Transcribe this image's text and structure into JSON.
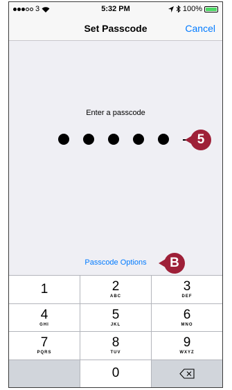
{
  "status_bar": {
    "carrier": "3",
    "time": "5:32 PM",
    "battery": "100%",
    "battery_level": 1.0,
    "signal_bars_filled": 3
  },
  "nav": {
    "title": "Set Passcode",
    "cancel": "Cancel"
  },
  "prompt": "Enter a passcode",
  "passcode": {
    "digits_entered": 5,
    "digits_total": 6
  },
  "options_link": "Passcode Options",
  "keypad": {
    "keys": [
      {
        "num": "1",
        "letters": ""
      },
      {
        "num": "2",
        "letters": "ABC"
      },
      {
        "num": "3",
        "letters": "DEF"
      },
      {
        "num": "4",
        "letters": "GHI"
      },
      {
        "num": "5",
        "letters": "JKL"
      },
      {
        "num": "6",
        "letters": "MNO"
      },
      {
        "num": "7",
        "letters": "PQRS"
      },
      {
        "num": "8",
        "letters": "TUV"
      },
      {
        "num": "9",
        "letters": "WXYZ"
      }
    ],
    "zero": "0",
    "delete_icon": "backspace-icon"
  },
  "callouts": {
    "five": "5",
    "b": "B",
    "color": "#9e2038"
  },
  "colors": {
    "accent": "#007aff",
    "battery": "#4cd964"
  }
}
